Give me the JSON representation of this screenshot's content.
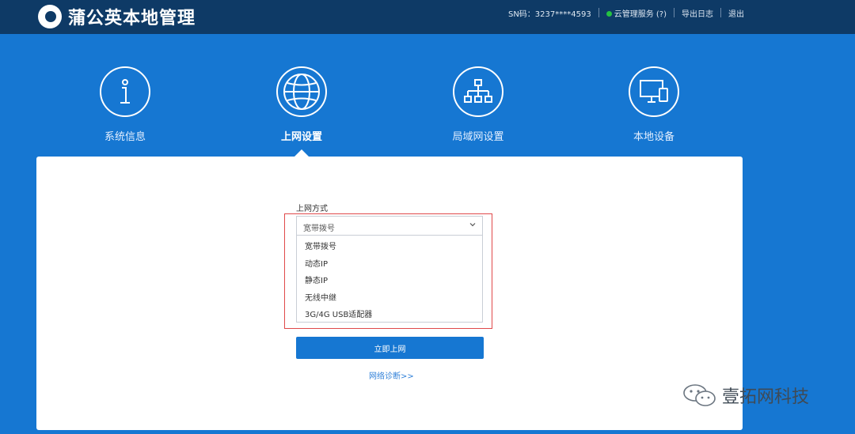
{
  "header": {
    "brand": "蒲公英本地管理",
    "sn": "SN码：3237****4593",
    "cloud_service": "云管理服务 (?)",
    "export_log": "导出日志",
    "logout": "退出",
    "status_color": "#25c241"
  },
  "nav": {
    "items": [
      {
        "label": "系统信息",
        "icon": "info-icon"
      },
      {
        "label": "上网设置",
        "icon": "globe-icon",
        "active": true
      },
      {
        "label": "局域网设置",
        "icon": "network-tree-icon"
      },
      {
        "label": "本地设备",
        "icon": "devices-icon"
      }
    ]
  },
  "form": {
    "label": "上网方式",
    "selected": "宽带拨号",
    "options": [
      "宽带拨号",
      "动态IP",
      "静态IP",
      "无线中继",
      "3G/4G USB适配器"
    ],
    "submit": "立即上网",
    "diagnose_link": "网络诊断>>"
  },
  "watermark": {
    "text": "壹拓网科技"
  },
  "colors": {
    "background": "#1677d2",
    "topbar": "#0e3a66",
    "highlight_border": "#e0494a"
  }
}
